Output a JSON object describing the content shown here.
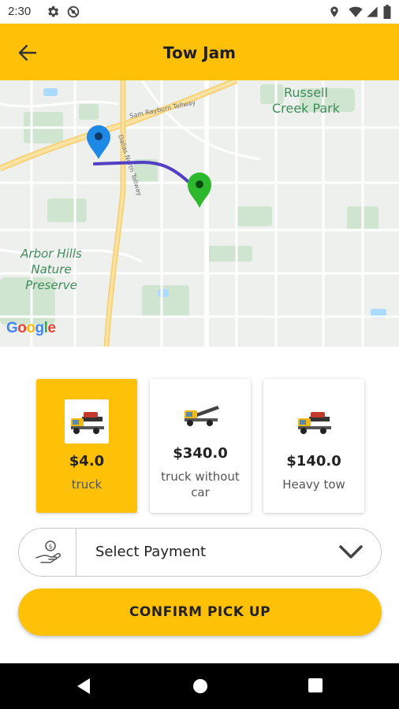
{
  "status_bar": {
    "time": "2:30",
    "left_icons": [
      "gear-icon",
      "no-sim-icon"
    ],
    "right_icons": [
      "location-icon",
      "wifi-icon",
      "signal-icon",
      "battery-icon"
    ]
  },
  "app_bar": {
    "title": "Tow Jam",
    "back_icon": "arrow-back-icon",
    "color": "#FFC107"
  },
  "map": {
    "labels": {
      "russell": "Russell Creek Park",
      "arbor": "Arbor Hills Nature Preserve",
      "tollway": "Sam Rayburn Tollway",
      "dallas": "Dallas North Tollway"
    },
    "provider_logo": [
      "G",
      "o",
      "o",
      "g",
      "l",
      "e"
    ],
    "markers": {
      "origin_color": "#1E88E5",
      "destination_color": "#2DB82D",
      "route_color": "#5140C4"
    }
  },
  "vehicles": [
    {
      "price": "$4.0",
      "label": "truck",
      "selected": true,
      "icon": "tow-truck-with-car-icon"
    },
    {
      "price": "$340.0",
      "label": "truck without car",
      "selected": false,
      "icon": "flatbed-truck-icon"
    },
    {
      "price": "$140.0",
      "label": "Heavy tow",
      "selected": false,
      "icon": "tow-truck-with-car-icon"
    }
  ],
  "payment": {
    "label": "Select Payment",
    "icon": "hand-money-icon",
    "chevron_icon": "chevron-down-icon"
  },
  "confirm_button": {
    "label": "CONFIRM PICK UP"
  },
  "nav_bar": {
    "icons": [
      "nav-back-icon",
      "nav-home-icon",
      "nav-recents-icon"
    ]
  },
  "colors": {
    "accent": "#FFC107",
    "text": "#222222"
  }
}
